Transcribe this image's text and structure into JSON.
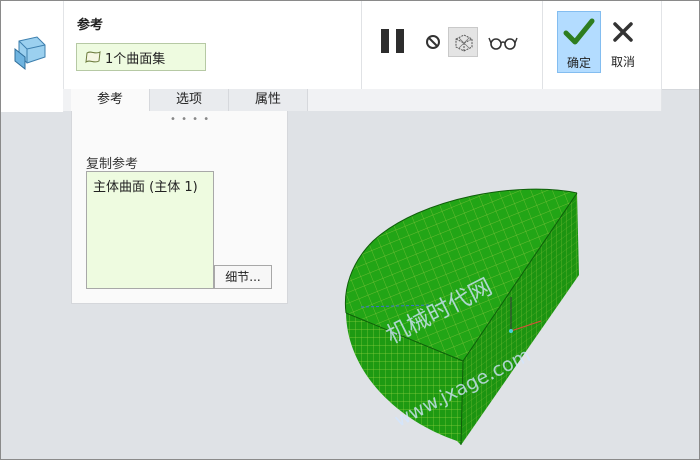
{
  "dashboard": {
    "title": "参考",
    "collector_value": "1个曲面集",
    "ok_label": "确定",
    "cancel_label": "取消"
  },
  "tabs": [
    {
      "label": "参考",
      "active": true
    },
    {
      "label": "选项",
      "active": false
    },
    {
      "label": "属性",
      "active": false
    }
  ],
  "panel": {
    "copy_label": "复制参考",
    "list_items": [
      "主体曲面 (主体 1)"
    ],
    "details_label": "细节..."
  },
  "viewport": {
    "watermark_cn": "机械时代网",
    "watermark_url": "www.jxage.com",
    "model_color": "#1fa114",
    "mesh_color": "#7fc23a"
  },
  "icons": {
    "feature": "copy-surface-icon",
    "pause": "pause-icon",
    "stop": "no-entry-icon",
    "preview": "mesh-preview-icon",
    "verify": "glasses-icon",
    "ok": "checkmark-icon",
    "cancel": "x-icon"
  }
}
